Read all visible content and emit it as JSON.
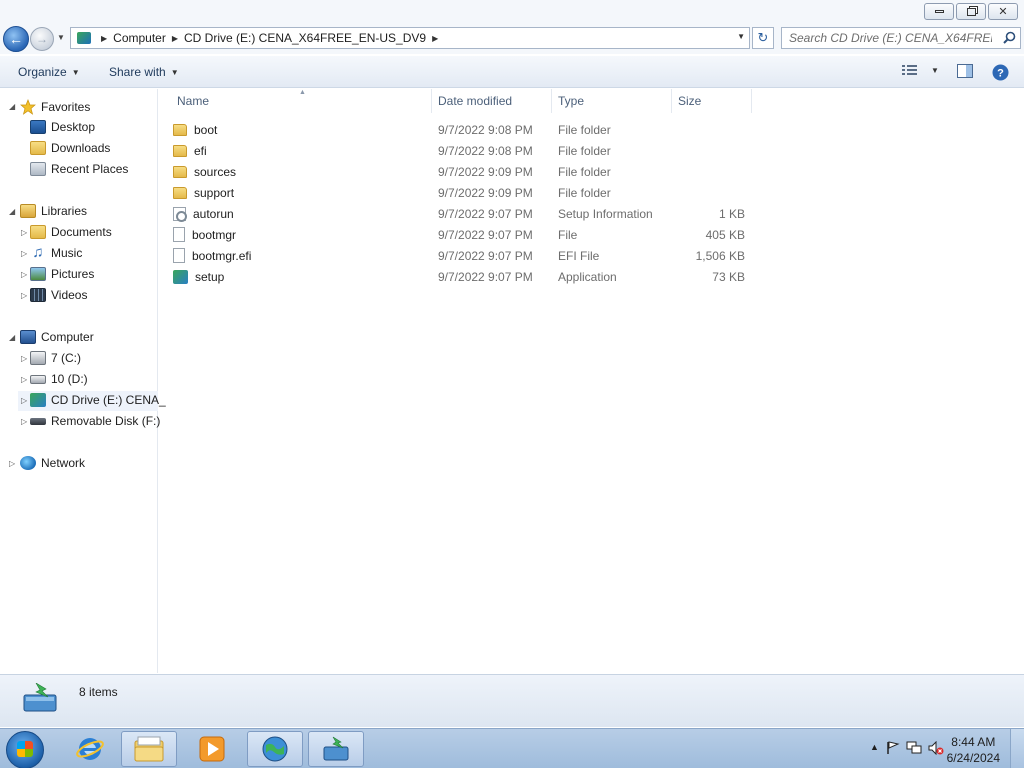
{
  "window": {
    "controls": {
      "minimize": "▭",
      "restore": "🗗",
      "close": "✕"
    }
  },
  "address": {
    "crumbs": [
      "Computer",
      "CD Drive (E:) CENA_X64FREE_EN-US_DV9"
    ],
    "search_placeholder": "Search CD Drive (E:) CENA_X64FREE_E..."
  },
  "toolbar": {
    "organize_label": "Organize",
    "share_label": "Share with"
  },
  "nav": {
    "favorites": {
      "label": "Favorites",
      "items": [
        "Desktop",
        "Downloads",
        "Recent Places"
      ]
    },
    "libraries": {
      "label": "Libraries",
      "items": [
        "Documents",
        "Music",
        "Pictures",
        "Videos"
      ]
    },
    "computer": {
      "label": "Computer",
      "items": [
        "7 (C:)",
        "10 (D:)",
        "CD Drive (E:) CENA_",
        "Removable Disk (F:)"
      ]
    },
    "network": {
      "label": "Network"
    }
  },
  "files": {
    "columns": {
      "name": "Name",
      "date": "Date modified",
      "type": "Type",
      "size": "Size"
    },
    "rows": [
      {
        "name": "boot",
        "date": "9/7/2022 9:08 PM",
        "type": "File folder",
        "size": "",
        "icon": "folder-icon"
      },
      {
        "name": "efi",
        "date": "9/7/2022 9:08 PM",
        "type": "File folder",
        "size": "",
        "icon": "folder-icon"
      },
      {
        "name": "sources",
        "date": "9/7/2022 9:09 PM",
        "type": "File folder",
        "size": "",
        "icon": "folder-icon"
      },
      {
        "name": "support",
        "date": "9/7/2022 9:09 PM",
        "type": "File folder",
        "size": "",
        "icon": "folder-icon"
      },
      {
        "name": "autorun",
        "date": "9/7/2022 9:07 PM",
        "type": "Setup Information",
        "size": "1 KB",
        "icon": "setup-info-icon"
      },
      {
        "name": "bootmgr",
        "date": "9/7/2022 9:07 PM",
        "type": "File",
        "size": "405 KB",
        "icon": "file-icon"
      },
      {
        "name": "bootmgr.efi",
        "date": "9/7/2022 9:07 PM",
        "type": "EFI File",
        "size": "1,506 KB",
        "icon": "file-icon"
      },
      {
        "name": "setup",
        "date": "9/7/2022 9:07 PM",
        "type": "Application",
        "size": "73 KB",
        "icon": "setup-app-icon"
      }
    ]
  },
  "details": {
    "item_count": "8 items"
  },
  "taskbar": {
    "clock_time": "8:44 AM",
    "clock_date": "6/24/2024"
  },
  "colors": {
    "accent": "#1e395b",
    "selection": "#eef3fb",
    "taskbar": "#a8c2e0"
  }
}
